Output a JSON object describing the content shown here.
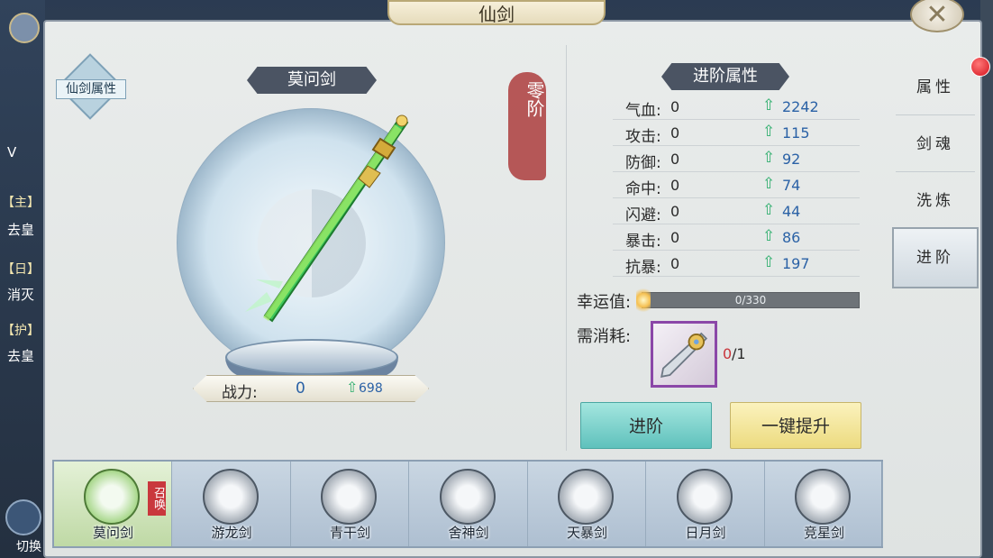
{
  "left_hud": {
    "tags": [
      "【主】",
      "【日】",
      "【护】"
    ],
    "texts": [
      "去皇",
      "消灭",
      "去皇"
    ],
    "bottom_label": "切换",
    "vip_text": "V"
  },
  "panel": {
    "title": "仙剑",
    "close_icon": "close-icon"
  },
  "attr_badge": {
    "label": "仙剑属性"
  },
  "sword_display": {
    "name": "莫问剑",
    "rank": "零阶",
    "power_label": "战力:",
    "power_value": "0",
    "power_up": "698"
  },
  "stats": {
    "banner": "进阶属性",
    "rows": [
      {
        "name": "气血:",
        "current": "0",
        "up": "2242"
      },
      {
        "name": "攻击:",
        "current": "0",
        "up": "115"
      },
      {
        "name": "防御:",
        "current": "0",
        "up": "92"
      },
      {
        "name": "命中:",
        "current": "0",
        "up": "74"
      },
      {
        "name": "闪避:",
        "current": "0",
        "up": "44"
      },
      {
        "name": "暴击:",
        "current": "0",
        "up": "86"
      },
      {
        "name": "抗暴:",
        "current": "0",
        "up": "197"
      }
    ]
  },
  "luck": {
    "label": "幸运值:",
    "text": "0/330",
    "fraction": 0.0
  },
  "cost": {
    "label": "需消耗:",
    "have": "0",
    "need": "/1"
  },
  "buttons": {
    "advance": "进阶",
    "oneclick": "一键提升"
  },
  "tabs": [
    {
      "label": "属性"
    },
    {
      "label": "剑魂"
    },
    {
      "label": "洗炼"
    },
    {
      "label": "进阶"
    }
  ],
  "sword_list": {
    "summon_badge": "召唤",
    "items": [
      {
        "name": "莫问剑"
      },
      {
        "name": "游龙剑"
      },
      {
        "name": "青干剑"
      },
      {
        "name": "舍神剑"
      },
      {
        "name": "天暴剑"
      },
      {
        "name": "日月剑"
      },
      {
        "name": "竞星剑"
      }
    ]
  },
  "colors": {
    "accent_up": "#2eae6d",
    "value_blue": "#2b62a6",
    "rank_red": "#b14a4a",
    "advance_button": "#5fc1bc",
    "oneclick_button": "#ecdb7f"
  }
}
